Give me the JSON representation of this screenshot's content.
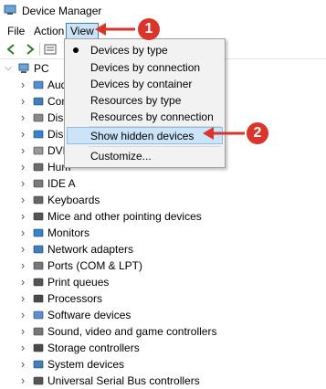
{
  "window": {
    "title": "Device Manager",
    "accent": "#d9352b",
    "highlight": "#cce4f7"
  },
  "menubar": {
    "file": "File",
    "action": "Action",
    "view": "View"
  },
  "tree": {
    "root": "PC",
    "items": [
      {
        "label": "Aud",
        "icon": "audio-icon"
      },
      {
        "label": "Com",
        "icon": "computer-icon"
      },
      {
        "label": "Disk",
        "icon": "disk-icon"
      },
      {
        "label": "Disp",
        "icon": "display-icon"
      },
      {
        "label": "DVD",
        "icon": "dvd-icon"
      },
      {
        "label": "Hum",
        "icon": "hid-icon"
      },
      {
        "label": "IDE A",
        "icon": "ide-icon"
      },
      {
        "label": "Keyboards",
        "icon": "keyboard-icon"
      },
      {
        "label": "Mice and other pointing devices",
        "icon": "mouse-icon"
      },
      {
        "label": "Monitors",
        "icon": "monitor-icon"
      },
      {
        "label": "Network adapters",
        "icon": "network-icon"
      },
      {
        "label": "Ports (COM & LPT)",
        "icon": "port-icon"
      },
      {
        "label": "Print queues",
        "icon": "printer-icon"
      },
      {
        "label": "Processors",
        "icon": "processor-icon"
      },
      {
        "label": "Software devices",
        "icon": "software-device-icon"
      },
      {
        "label": "Sound, video and game controllers",
        "icon": "sound-icon"
      },
      {
        "label": "Storage controllers",
        "icon": "storage-icon"
      },
      {
        "label": "System devices",
        "icon": "system-icon"
      },
      {
        "label": "Universal Serial Bus controllers",
        "icon": "usb-icon"
      }
    ]
  },
  "view_menu": {
    "items": [
      "Devices by type",
      "Devices by connection",
      "Devices by container",
      "Resources by type",
      "Resources by connection",
      "Show hidden devices",
      "Customize..."
    ],
    "selected": "Devices by type",
    "highlighted": "Show hidden devices"
  },
  "callouts": {
    "one": "1",
    "two": "2"
  }
}
